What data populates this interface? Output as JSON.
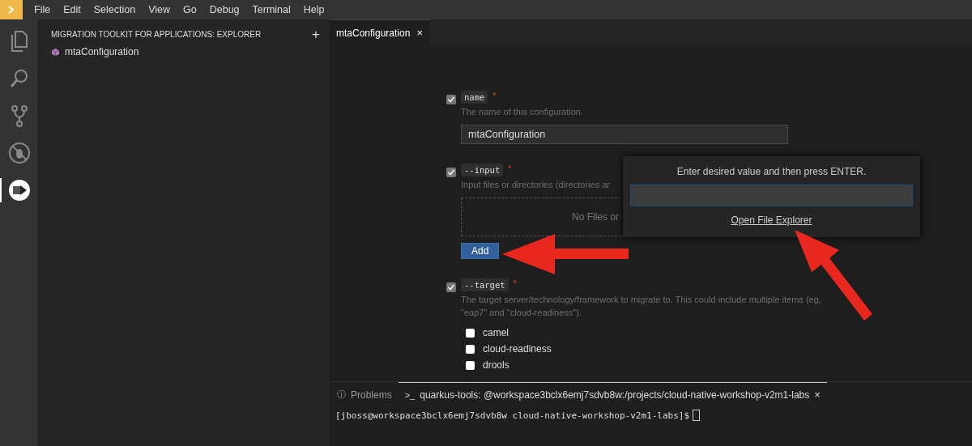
{
  "menu": [
    "File",
    "Edit",
    "Selection",
    "View",
    "Go",
    "Debug",
    "Terminal",
    "Help"
  ],
  "activity_bar": [
    {
      "kind": "files",
      "selected": false
    },
    {
      "kind": "search",
      "selected": false
    },
    {
      "kind": "scm",
      "selected": false
    },
    {
      "kind": "debug",
      "selected": false
    },
    {
      "kind": "mta",
      "selected": true
    }
  ],
  "sidebar": {
    "title": "MIGRATION TOOLKIT FOR APPLICATIONS: EXPLORER",
    "add": "+",
    "items": [
      {
        "label": "mtaConfiguration"
      }
    ]
  },
  "editor_tabs": [
    {
      "label": "mtaConfiguration",
      "close": "×",
      "selected": true
    }
  ],
  "form": {
    "options": [
      {
        "kind": "text",
        "checked": true,
        "flag": "name",
        "required": "*",
        "description": "The name of this configuration.",
        "value": "mtaConfiguration"
      },
      {
        "kind": "files",
        "checked": true,
        "flag": "--input",
        "required": "*",
        "description": "Input files or directories (directories ar",
        "empty_text": "No Files or",
        "button": "Add"
      },
      {
        "kind": "choices",
        "checked": true,
        "flag": "--target",
        "required": "*",
        "description": "The target server/technology/framework to migrate to. This could include multiple items (eg, \"eap7\" and \"cloud-readiness\").",
        "choices": [
          {
            "label": "camel",
            "checked": false
          },
          {
            "label": "cloud-readiness",
            "checked": false
          },
          {
            "label": "drools",
            "checked": false
          }
        ]
      }
    ]
  },
  "input_popup": {
    "prompt": "Enter desired value and then press ENTER.",
    "link": "Open File Explorer"
  },
  "panel": {
    "tabs": [
      {
        "icon": "ⓘ",
        "label": "Problems",
        "selected": false
      },
      {
        "icon": ">_",
        "label": "quarkus-tools: @workspace3bclx6emj7sdvb8w:/projects/cloud-native-workshop-v2m1-labs",
        "close": "×",
        "selected": true
      }
    ],
    "terminal_line": "[jboss@workspace3bclx6emj7sdvb8w cloud-native-workshop-v2m1-labs]$"
  }
}
